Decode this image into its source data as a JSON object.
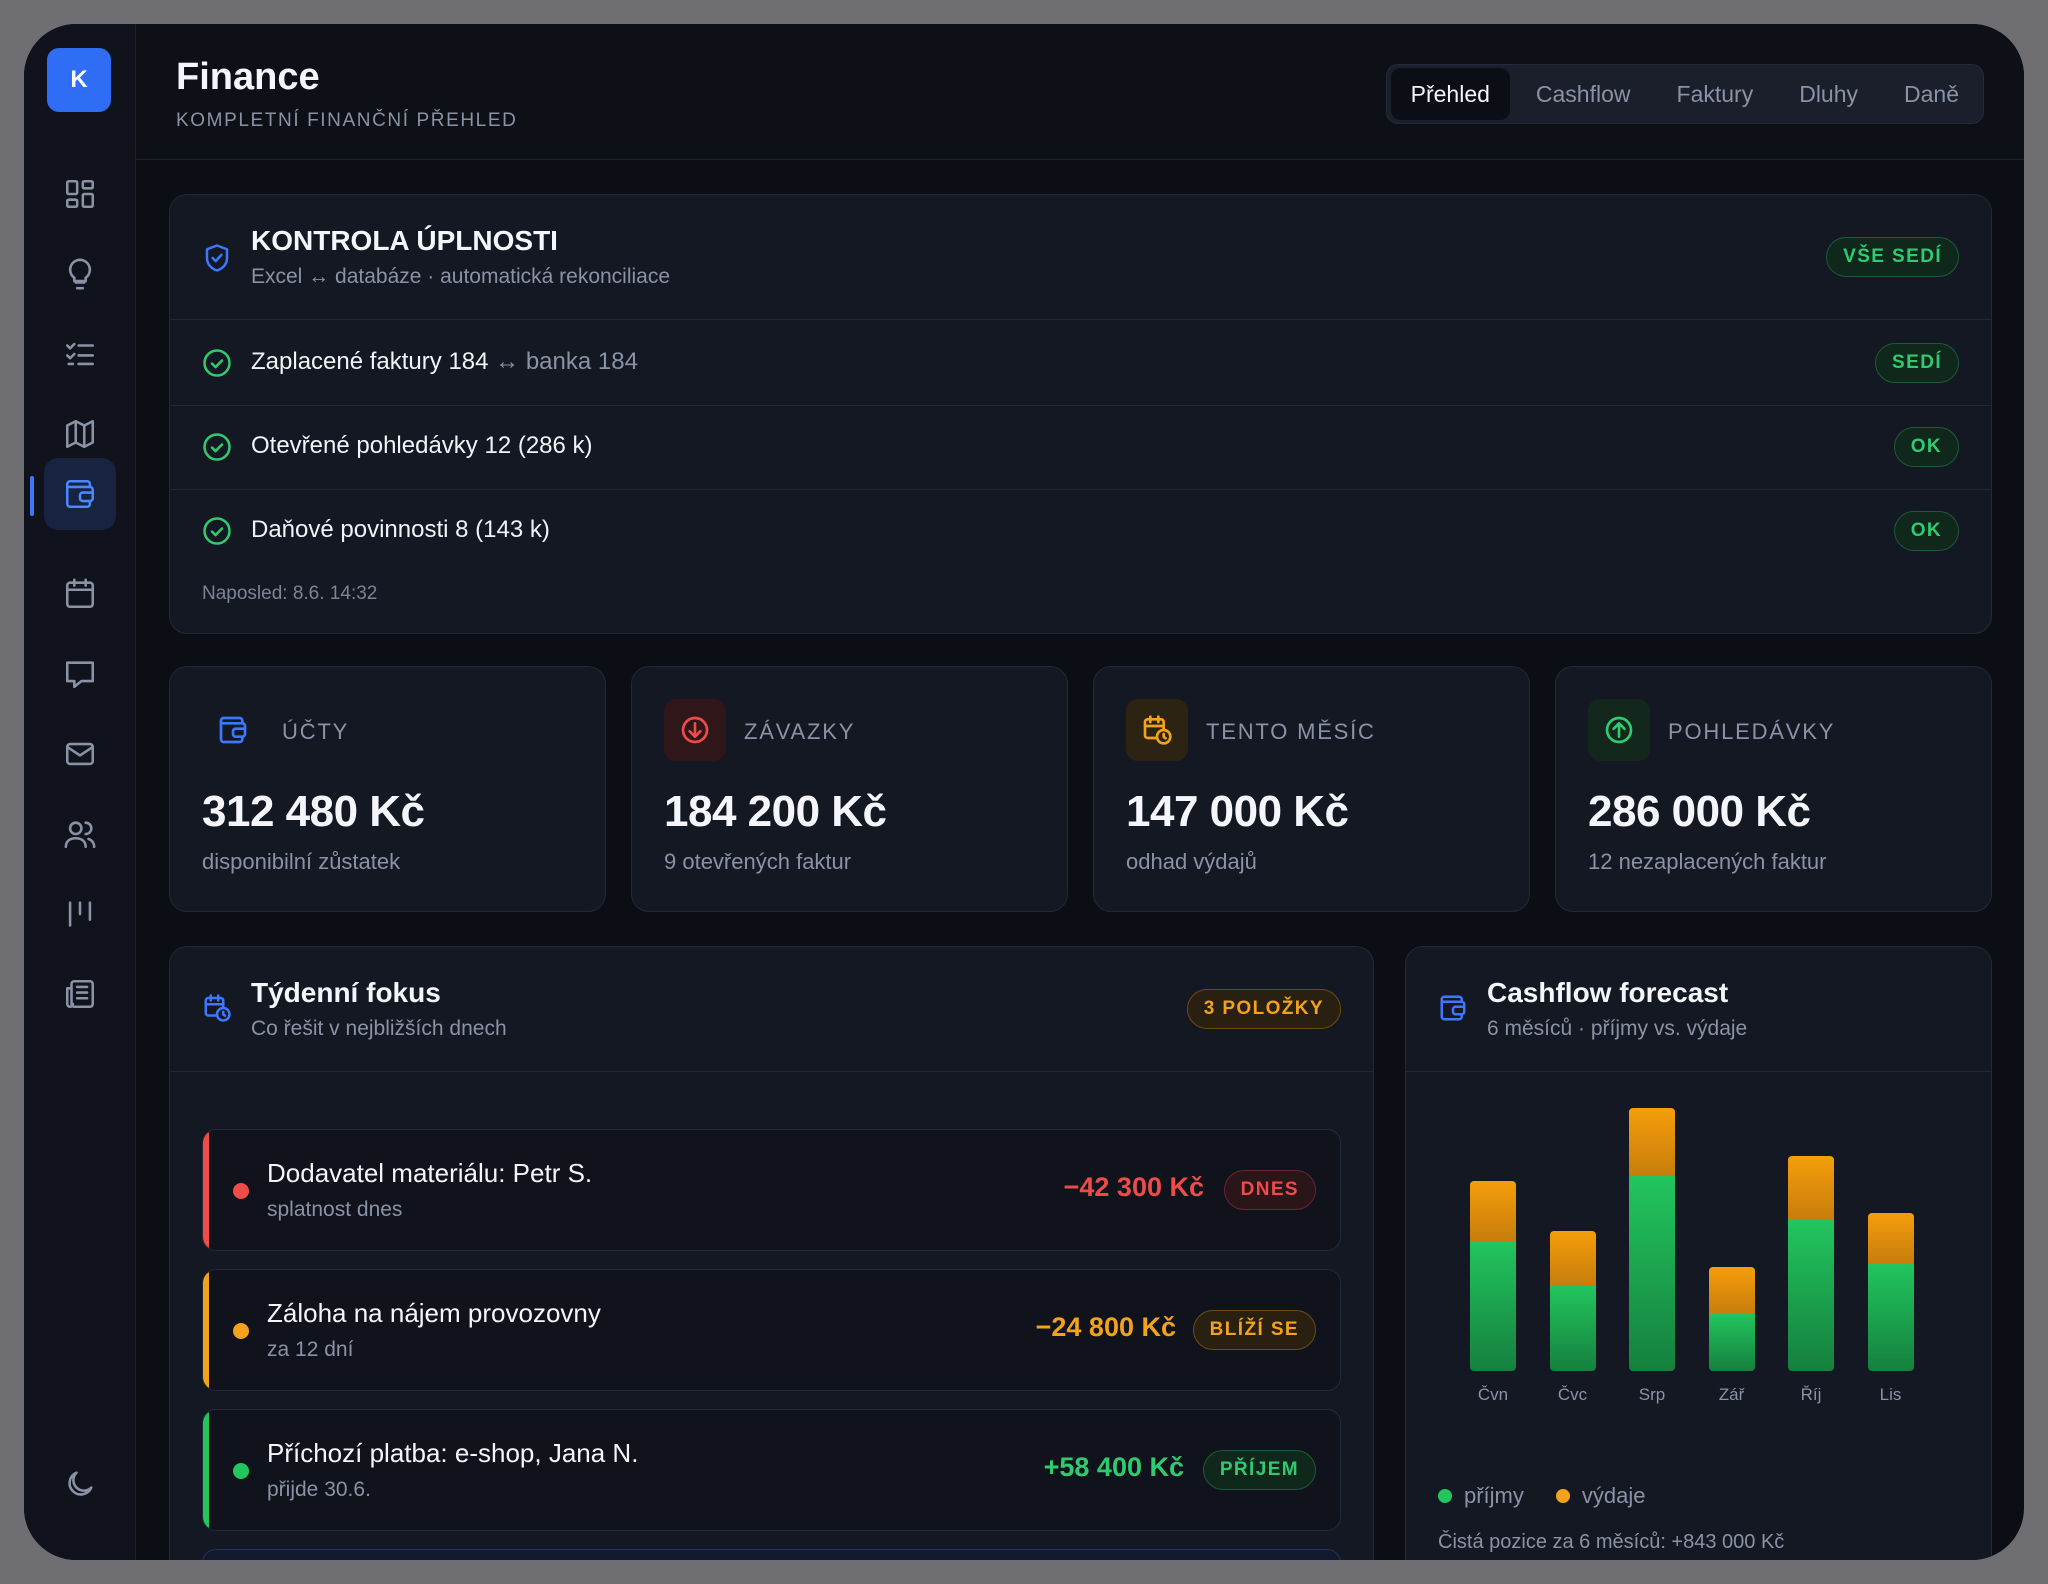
{
  "app": {
    "avatar_letter": "K",
    "title": "Finance",
    "subtitle": "KOMPLETNÍ FINANČNÍ PŘEHLED",
    "tabs": [
      "Přehled",
      "Cashflow",
      "Faktury",
      "Dluhy",
      "Daně"
    ],
    "active_tab": "Přehled"
  },
  "sidebar": {
    "items": [
      "dashboard-icon",
      "lightbulb-icon",
      "checklist-icon",
      "map-icon",
      "wallet-icon",
      "calendar-icon",
      "chat-icon",
      "mail-icon",
      "users-icon",
      "kanban-icon",
      "news-icon"
    ],
    "active": "wallet-icon",
    "footer": "moon-icon"
  },
  "completeness": {
    "title": "KONTROLA ÚPLNOSTI",
    "subtitle": "Excel ↔ databáze · automatická rekonciliace",
    "status": "VŠE SEDÍ",
    "rows": [
      {
        "main": "Zaplacené faktury 184",
        "muted": " ↔ banka 184",
        "badge": "SEDÍ"
      },
      {
        "main": "Otevřené pohledávky 12 (286 k)",
        "muted": "",
        "badge": "OK"
      },
      {
        "main": "Daňové povinnosti 8 (143 k)",
        "muted": "",
        "badge": "OK"
      }
    ],
    "last_run": "Naposled: 8.6. 14:32"
  },
  "kpis": [
    {
      "label": "ÚČTY",
      "value": "312 480 Kč",
      "sub": "disponibilní zůstatek",
      "icon": "wallet-icon",
      "color": "#3b78ff"
    },
    {
      "label": "ZÁVAZKY",
      "value": "184 200 Kč",
      "sub": "9 otevřených faktur",
      "icon": "arrow-down-circle-icon",
      "color": "#ef4b4b"
    },
    {
      "label": "TENTO MĚSÍC",
      "value": "147 000 Kč",
      "sub": "odhad výdajů",
      "icon": "calendar-clock-icon",
      "color": "#f2a31b"
    },
    {
      "label": "POHLEDÁVKY",
      "value": "286 000 Kč",
      "sub": "12 nezaplacených faktur",
      "icon": "arrow-up-circle-icon",
      "color": "#2ecc6f"
    }
  ],
  "focus": {
    "title": "Týdenní fokus",
    "subtitle": "Co řešit v nejbližších dnech",
    "count_badge": "3 POLOŽKY",
    "items": [
      {
        "title": "Dodavatel materiálu: Petr S.",
        "sub": "splatnost dnes",
        "amount": "−42 300 Kč",
        "badge": "DNES",
        "tone": "red"
      },
      {
        "title": "Záloha na nájem provozovny",
        "sub": "za 12 dní",
        "amount": "−24 800 Kč",
        "badge": "BLÍŽÍ SE",
        "tone": "amber"
      },
      {
        "title": "Příchozí platba: e-shop, Jana N.",
        "sub": "přijde 30.6.",
        "amount": "+58 400 Kč",
        "badge": "PŘÍJEM",
        "tone": "green"
      }
    ]
  },
  "forecast": {
    "title": "Cashflow forecast",
    "subtitle": "6 měsíců · příjmy vs. výdaje",
    "legend": [
      "příjmy",
      "výdaje"
    ],
    "net_position": "Čistá pozice za 6 měsíců: +843 000 Kč"
  },
  "chart_data": {
    "type": "bar",
    "stacked": true,
    "categories": [
      "Čvn",
      "Čvc",
      "Srp",
      "Zář",
      "Říj",
      "Lis"
    ],
    "series": [
      {
        "name": "příjmy",
        "values": [
          102,
          67,
          153,
          45,
          119,
          84
        ],
        "color": "#22c55e"
      },
      {
        "name": "výdaje",
        "values": [
          47,
          43,
          54,
          37,
          50,
          40
        ],
        "color": "#f2a31b"
      }
    ],
    "ylim": [
      0,
      220
    ],
    "legend_position": "bottom-left",
    "grid": false
  }
}
